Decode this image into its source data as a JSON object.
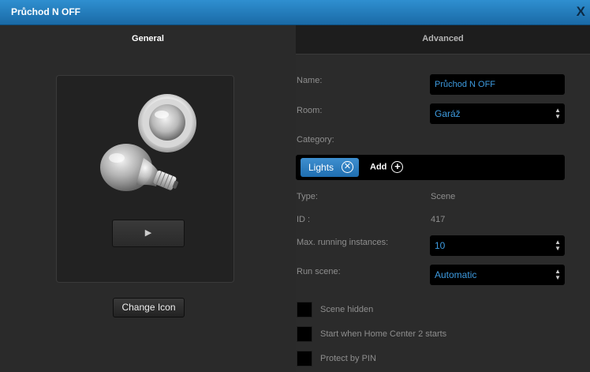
{
  "window": {
    "title": "Průchod N OFF",
    "close_label": "X"
  },
  "tabs": [
    {
      "label": "General"
    },
    {
      "label": "Advanced"
    }
  ],
  "left_panel": {
    "change_icon_label": "Change Icon",
    "play_symbol": "▶"
  },
  "form": {
    "name": {
      "label": "Name:",
      "value": "Průchod N OFF"
    },
    "room": {
      "label": "Room:",
      "value": "Garáž"
    },
    "category": {
      "label": "Category:",
      "tag": "Lights",
      "add_label": "Add"
    },
    "type": {
      "label": "Type:",
      "value": "Scene"
    },
    "id": {
      "label": "ID :",
      "value": "417"
    },
    "max_instances": {
      "label": "Max. running instances:",
      "value": "10"
    },
    "run_scene": {
      "label": "Run scene:",
      "value": "Automatic"
    },
    "checkboxes": [
      {
        "label": "Scene hidden",
        "checked": false
      },
      {
        "label": "Start when Home Center 2 starts",
        "checked": false
      },
      {
        "label": "Protect by PIN",
        "checked": false
      }
    ]
  },
  "colors": {
    "accent": "#3d9be0",
    "titlebar": "#1f78bb"
  },
  "icons": {
    "scene_icon": "bulb-and-sensor-icon",
    "select_arrow": "updown-arrow-icon"
  }
}
